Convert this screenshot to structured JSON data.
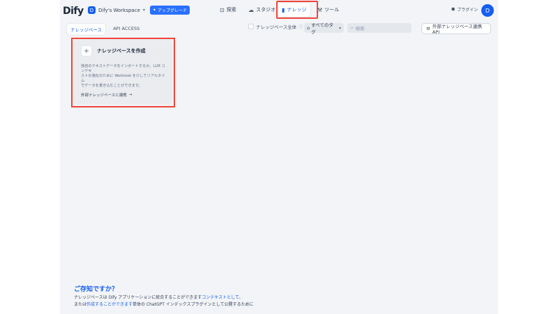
{
  "app": {
    "logo": "Dify"
  },
  "workspace": {
    "avatar": "D",
    "name": "Dify's Workspace",
    "upgrade": "アップグレード"
  },
  "nav": {
    "explore": "探索",
    "studio": "スタジオ",
    "knowledge": "ナレッジ",
    "tools": "ツール"
  },
  "header": {
    "plugins": "プラグイン",
    "user_avatar": "D"
  },
  "tabs": [
    {
      "label": "ナレッジベース",
      "active": true
    },
    {
      "label": "API ACCESS",
      "active": false
    }
  ],
  "toolbar": {
    "all_knowledge": "ナレッジベース全体",
    "tags": "すべてのタグ",
    "search_placeholder": "検索",
    "external_api": "外部ナレッジベース連携 API"
  },
  "create_card": {
    "title": "ナレッジベースを作成",
    "desc_1": "独自のテキストデータをインポートするか、LLM コンテキ",
    "desc_2": "ストの強化のために Webhook を介してリアルタイム",
    "desc_3": "でデータを書き込むことができます。",
    "link": "外部ナレッジベースと連携"
  },
  "tips": {
    "heading": "ご存知ですか？",
    "line1_a": "ナレッジベースは Dify アプリケーションに統合することができます",
    "line1_link": "コンテキストとして",
    "line1_b": "、",
    "line2_a": "または",
    "line2_link": "作成することができます",
    "line2_b": "単体の ChatGPT インデックスプラグインとして公開するために"
  },
  "colors": {
    "accent": "#155eef",
    "highlight": "#f04438",
    "background": "#f2f4f7"
  }
}
